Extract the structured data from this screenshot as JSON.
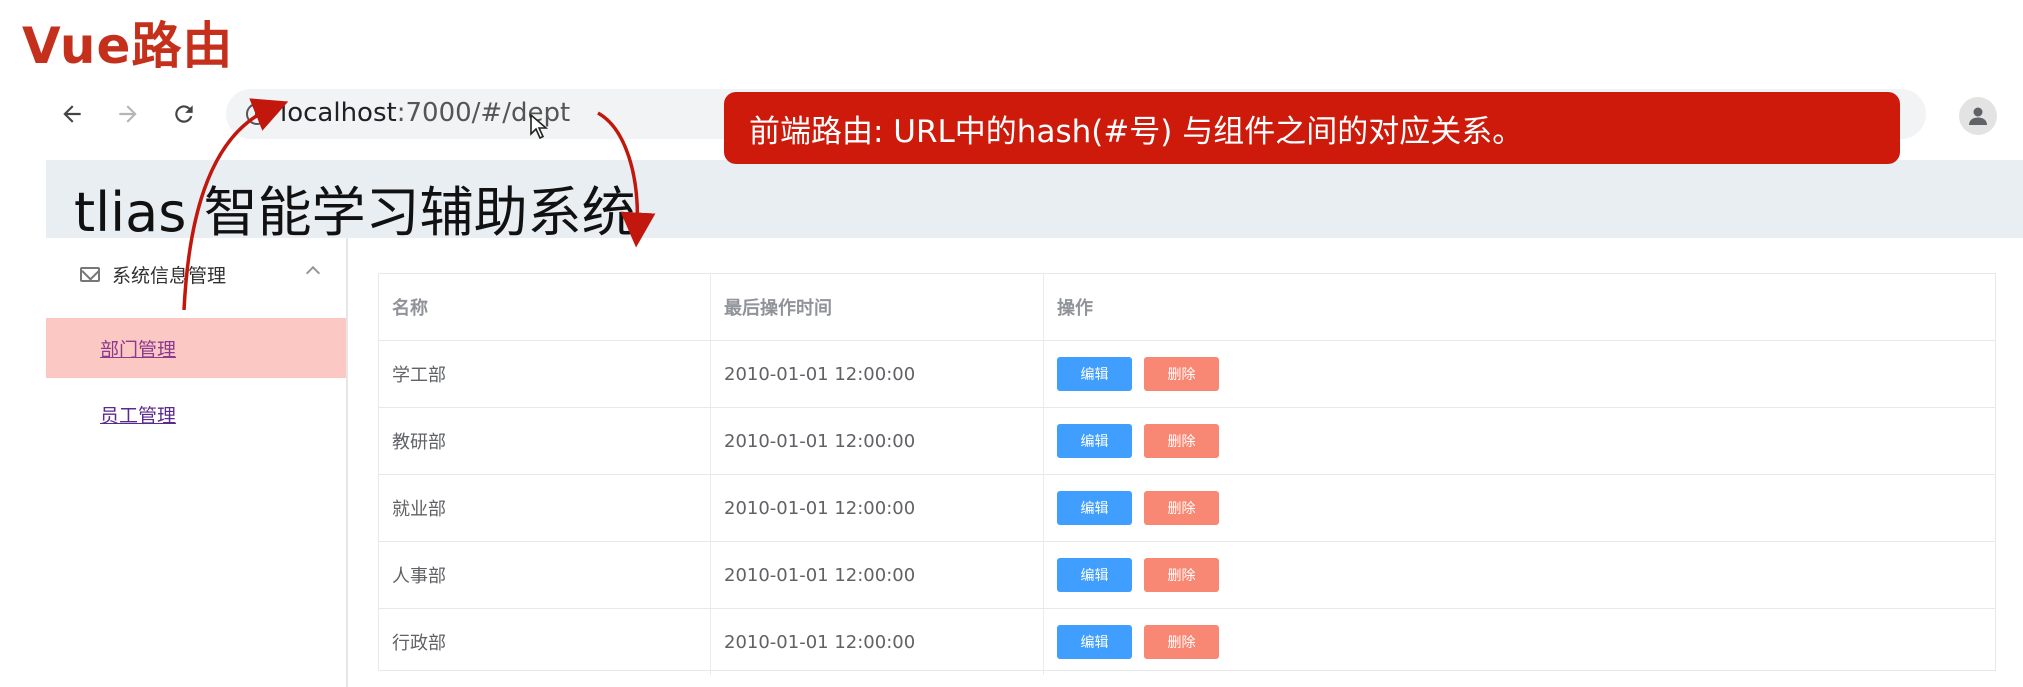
{
  "slide": {
    "title": "Vue路由"
  },
  "browser": {
    "url_host": "localhost",
    "url_path": ":7000/#/dept"
  },
  "callout": {
    "text": "前端路由: URL中的hash(#号) 与组件之间的对应关系。"
  },
  "app": {
    "title": "tlias 智能学习辅助系统"
  },
  "sidebar": {
    "group_label": "系统信息管理",
    "items": [
      {
        "label": "部门管理",
        "active": true
      },
      {
        "label": "员工管理",
        "active": false
      }
    ]
  },
  "table": {
    "columns": [
      "名称",
      "最后操作时间",
      "操作"
    ],
    "rows": [
      {
        "name": "学工部",
        "time": "2010-01-01 12:00:00"
      },
      {
        "name": "教研部",
        "time": "2010-01-01 12:00:00"
      },
      {
        "name": "就业部",
        "time": "2010-01-01 12:00:00"
      },
      {
        "name": "人事部",
        "time": "2010-01-01 12:00:00"
      },
      {
        "name": "行政部",
        "time": "2010-01-01 12:00:00"
      }
    ],
    "edit_label": "编辑",
    "delete_label": "删除"
  },
  "colors": {
    "annotation_red": "#cd1a0b",
    "title_red": "#c4301c",
    "edit_blue": "#409eff",
    "delete_salmon": "#f88873",
    "active_menu_bg": "#fbc8c3",
    "header_bg": "#e9eef3"
  }
}
